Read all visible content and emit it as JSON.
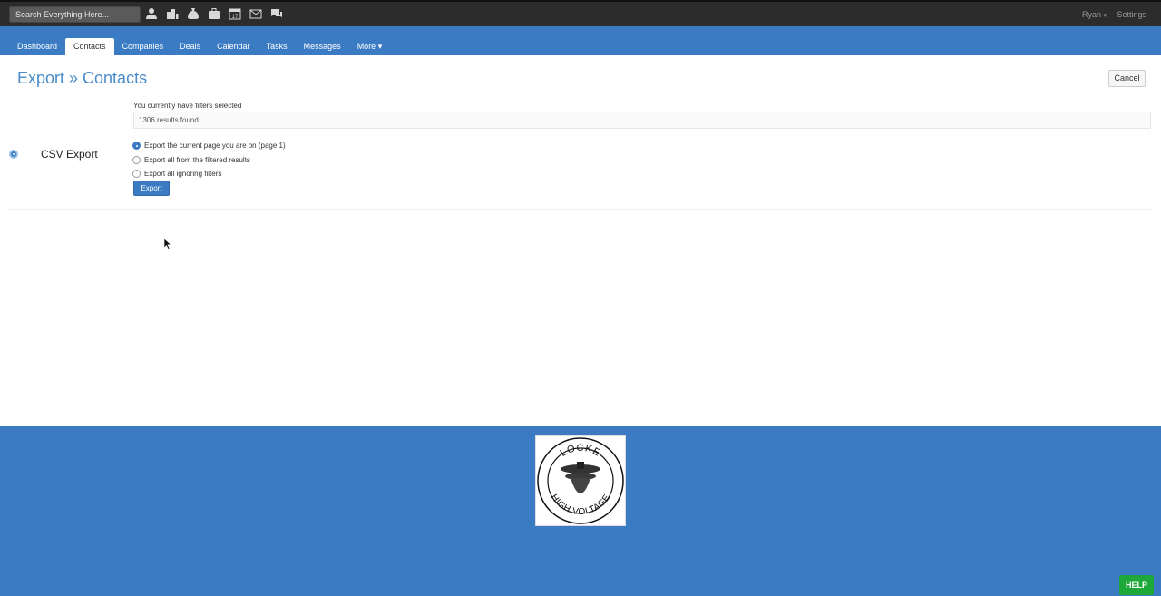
{
  "search": {
    "placeholder": "Search Everything Here..."
  },
  "top_icons": [
    "person-icon",
    "buildings-icon",
    "money-bag-icon",
    "briefcase-icon",
    "calendar-icon",
    "envelope-icon",
    "chat-icon"
  ],
  "calendar_icon_day": "17",
  "user": {
    "name": "Ryan",
    "caret": "▾"
  },
  "settings_label": "Settings",
  "nav": {
    "tabs": [
      {
        "label": "Dashboard"
      },
      {
        "label": "Contacts"
      },
      {
        "label": "Companies"
      },
      {
        "label": "Deals"
      },
      {
        "label": "Calendar"
      },
      {
        "label": "Tasks"
      },
      {
        "label": "Messages"
      },
      {
        "label": "More ▾"
      }
    ]
  },
  "page": {
    "title": "Export » Contacts",
    "cancel_label": "Cancel",
    "filter_note": "You currently have filters selected",
    "results": "1306 results found",
    "section_label": "CSV Export",
    "options": [
      {
        "label": "Export the current page you are on (page 1)",
        "checked": true
      },
      {
        "label": "Export all from the filtered results",
        "checked": false
      },
      {
        "label": "Export all ignoring filters",
        "checked": false
      }
    ],
    "export_label": "Export"
  },
  "logo": {
    "top_text": "LOCKE",
    "bottom_text": "HIGH VOLTAGE"
  },
  "help_label": "HELP",
  "colors": {
    "brand_blue": "#3a7bc3",
    "title_blue": "#4a8bc9",
    "help_green": "#1fa83a",
    "topbar": "#2c2c2c"
  }
}
